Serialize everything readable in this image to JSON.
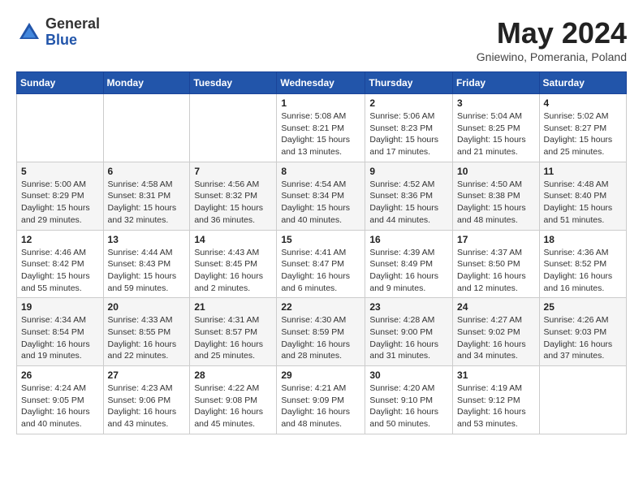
{
  "logo": {
    "general": "General",
    "blue": "Blue"
  },
  "title": "May 2024",
  "subtitle": "Gniewino, Pomerania, Poland",
  "days_of_week": [
    "Sunday",
    "Monday",
    "Tuesday",
    "Wednesday",
    "Thursday",
    "Friday",
    "Saturday"
  ],
  "weeks": [
    [
      {
        "day": "",
        "info": ""
      },
      {
        "day": "",
        "info": ""
      },
      {
        "day": "",
        "info": ""
      },
      {
        "day": "1",
        "info": "Sunrise: 5:08 AM\nSunset: 8:21 PM\nDaylight: 15 hours\nand 13 minutes."
      },
      {
        "day": "2",
        "info": "Sunrise: 5:06 AM\nSunset: 8:23 PM\nDaylight: 15 hours\nand 17 minutes."
      },
      {
        "day": "3",
        "info": "Sunrise: 5:04 AM\nSunset: 8:25 PM\nDaylight: 15 hours\nand 21 minutes."
      },
      {
        "day": "4",
        "info": "Sunrise: 5:02 AM\nSunset: 8:27 PM\nDaylight: 15 hours\nand 25 minutes."
      }
    ],
    [
      {
        "day": "5",
        "info": "Sunrise: 5:00 AM\nSunset: 8:29 PM\nDaylight: 15 hours\nand 29 minutes."
      },
      {
        "day": "6",
        "info": "Sunrise: 4:58 AM\nSunset: 8:31 PM\nDaylight: 15 hours\nand 32 minutes."
      },
      {
        "day": "7",
        "info": "Sunrise: 4:56 AM\nSunset: 8:32 PM\nDaylight: 15 hours\nand 36 minutes."
      },
      {
        "day": "8",
        "info": "Sunrise: 4:54 AM\nSunset: 8:34 PM\nDaylight: 15 hours\nand 40 minutes."
      },
      {
        "day": "9",
        "info": "Sunrise: 4:52 AM\nSunset: 8:36 PM\nDaylight: 15 hours\nand 44 minutes."
      },
      {
        "day": "10",
        "info": "Sunrise: 4:50 AM\nSunset: 8:38 PM\nDaylight: 15 hours\nand 48 minutes."
      },
      {
        "day": "11",
        "info": "Sunrise: 4:48 AM\nSunset: 8:40 PM\nDaylight: 15 hours\nand 51 minutes."
      }
    ],
    [
      {
        "day": "12",
        "info": "Sunrise: 4:46 AM\nSunset: 8:42 PM\nDaylight: 15 hours\nand 55 minutes."
      },
      {
        "day": "13",
        "info": "Sunrise: 4:44 AM\nSunset: 8:43 PM\nDaylight: 15 hours\nand 59 minutes."
      },
      {
        "day": "14",
        "info": "Sunrise: 4:43 AM\nSunset: 8:45 PM\nDaylight: 16 hours\nand 2 minutes."
      },
      {
        "day": "15",
        "info": "Sunrise: 4:41 AM\nSunset: 8:47 PM\nDaylight: 16 hours\nand 6 minutes."
      },
      {
        "day": "16",
        "info": "Sunrise: 4:39 AM\nSunset: 8:49 PM\nDaylight: 16 hours\nand 9 minutes."
      },
      {
        "day": "17",
        "info": "Sunrise: 4:37 AM\nSunset: 8:50 PM\nDaylight: 16 hours\nand 12 minutes."
      },
      {
        "day": "18",
        "info": "Sunrise: 4:36 AM\nSunset: 8:52 PM\nDaylight: 16 hours\nand 16 minutes."
      }
    ],
    [
      {
        "day": "19",
        "info": "Sunrise: 4:34 AM\nSunset: 8:54 PM\nDaylight: 16 hours\nand 19 minutes."
      },
      {
        "day": "20",
        "info": "Sunrise: 4:33 AM\nSunset: 8:55 PM\nDaylight: 16 hours\nand 22 minutes."
      },
      {
        "day": "21",
        "info": "Sunrise: 4:31 AM\nSunset: 8:57 PM\nDaylight: 16 hours\nand 25 minutes."
      },
      {
        "day": "22",
        "info": "Sunrise: 4:30 AM\nSunset: 8:59 PM\nDaylight: 16 hours\nand 28 minutes."
      },
      {
        "day": "23",
        "info": "Sunrise: 4:28 AM\nSunset: 9:00 PM\nDaylight: 16 hours\nand 31 minutes."
      },
      {
        "day": "24",
        "info": "Sunrise: 4:27 AM\nSunset: 9:02 PM\nDaylight: 16 hours\nand 34 minutes."
      },
      {
        "day": "25",
        "info": "Sunrise: 4:26 AM\nSunset: 9:03 PM\nDaylight: 16 hours\nand 37 minutes."
      }
    ],
    [
      {
        "day": "26",
        "info": "Sunrise: 4:24 AM\nSunset: 9:05 PM\nDaylight: 16 hours\nand 40 minutes."
      },
      {
        "day": "27",
        "info": "Sunrise: 4:23 AM\nSunset: 9:06 PM\nDaylight: 16 hours\nand 43 minutes."
      },
      {
        "day": "28",
        "info": "Sunrise: 4:22 AM\nSunset: 9:08 PM\nDaylight: 16 hours\nand 45 minutes."
      },
      {
        "day": "29",
        "info": "Sunrise: 4:21 AM\nSunset: 9:09 PM\nDaylight: 16 hours\nand 48 minutes."
      },
      {
        "day": "30",
        "info": "Sunrise: 4:20 AM\nSunset: 9:10 PM\nDaylight: 16 hours\nand 50 minutes."
      },
      {
        "day": "31",
        "info": "Sunrise: 4:19 AM\nSunset: 9:12 PM\nDaylight: 16 hours\nand 53 minutes."
      },
      {
        "day": "",
        "info": ""
      }
    ]
  ]
}
